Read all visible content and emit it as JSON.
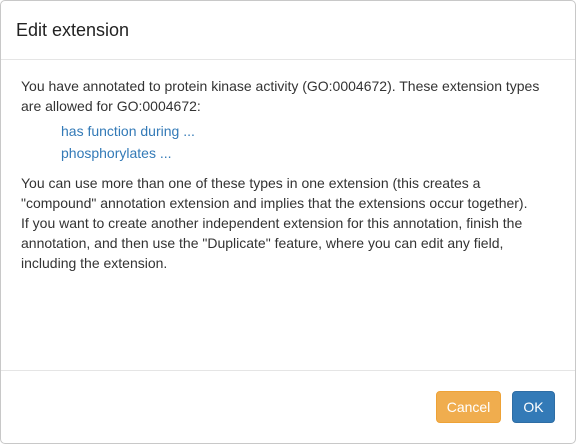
{
  "dialog": {
    "title": "Edit extension"
  },
  "body": {
    "intro": "You have annotated to protein kinase activity (GO:0004672). These extension types are allowed for GO:0004672:",
    "extension_types": [
      {
        "label": "has function during ..."
      },
      {
        "label": "phosphorylates ..."
      }
    ],
    "compound_note": "You can use more than one of these types in one extension (this creates a \"compound\" annotation extension and implies that the extensions occur together).",
    "duplicate_note": "If you want to create another independent extension for this annotation, finish the annotation, and then use the \"Duplicate\" feature, where you can edit any field, including the extension."
  },
  "footer": {
    "cancel_label": "Cancel",
    "ok_label": "OK"
  },
  "colors": {
    "link": "#337ab7",
    "cancel_button": "#f0ad4e",
    "ok_button": "#337ab7"
  }
}
